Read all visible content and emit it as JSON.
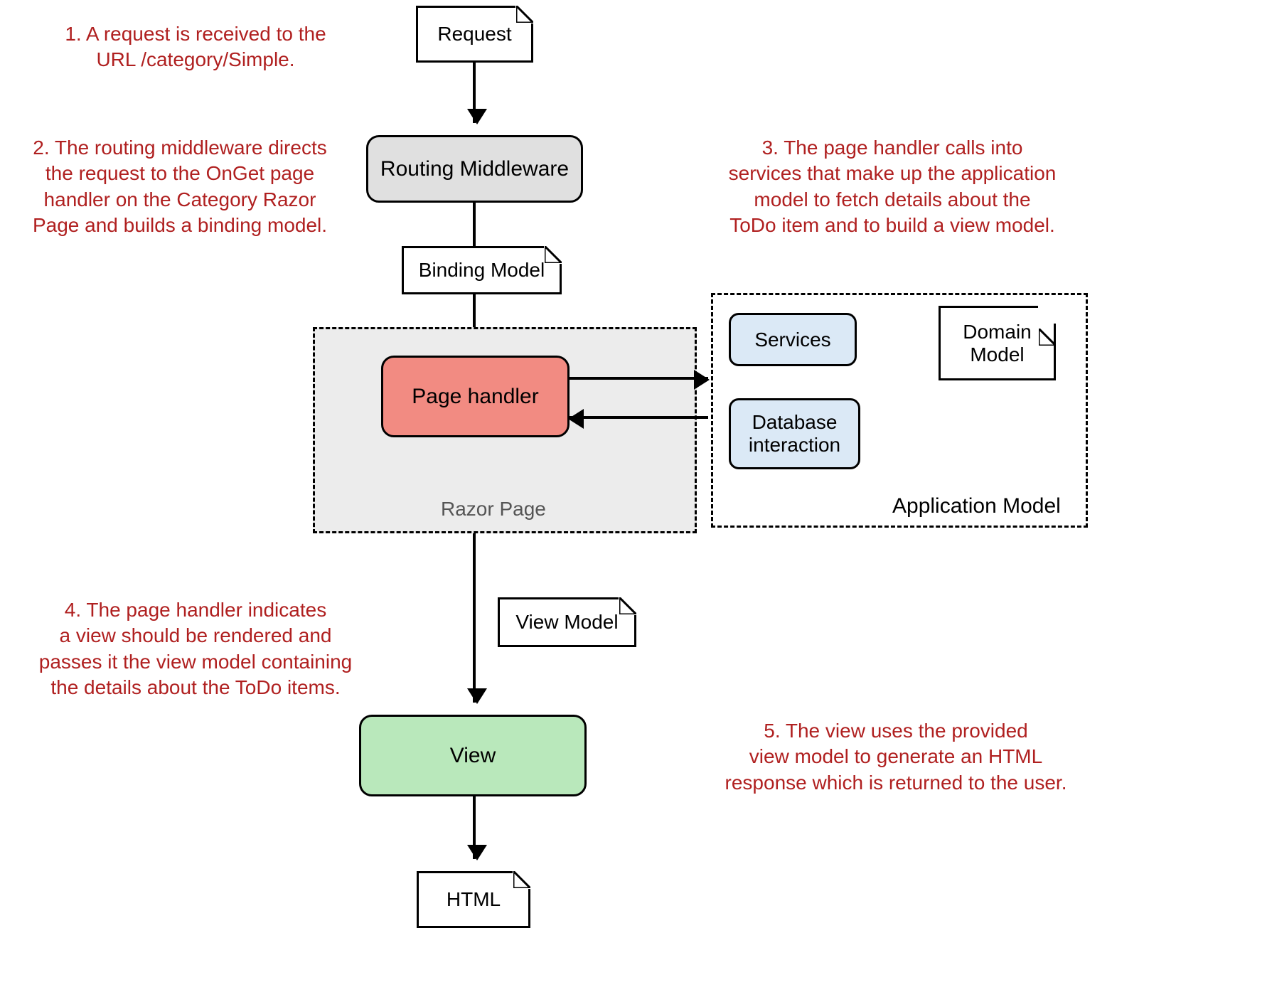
{
  "annotations": {
    "a1": "1. A request is received to the\nURL /category/Simple.",
    "a2": "2. The routing middleware directs\nthe request to the OnGet page\nhandler on the Category Razor\nPage and builds a binding model.",
    "a3": "3. The page handler calls into\nservices that make up the application\nmodel to fetch details about the\nToDo item and to build a view model.",
    "a4": "4. The page handler indicates\na view should be rendered and\npasses it the view model containing\nthe details about the ToDo items.",
    "a5": "5. The view uses the provided\nview model to generate an HTML\nresponse which is returned to the user."
  },
  "docs": {
    "request": "Request",
    "binding_model": "Binding Model",
    "view_model": "View Model",
    "html": "HTML",
    "domain_model": "Domain\nModel"
  },
  "blocks": {
    "routing_middleware": "Routing Middleware",
    "page_handler": "Page handler",
    "view": "View",
    "services": "Services",
    "database_interaction": "Database\ninteraction"
  },
  "containers": {
    "razor_page": "Razor Page",
    "application_model": "Application Model"
  },
  "colors": {
    "annotation": "#b02020",
    "grey_fill": "#e0e0e0",
    "red_fill": "#f28b82",
    "green_fill": "#b9e8bb",
    "blue_fill": "#dbe9f6"
  }
}
